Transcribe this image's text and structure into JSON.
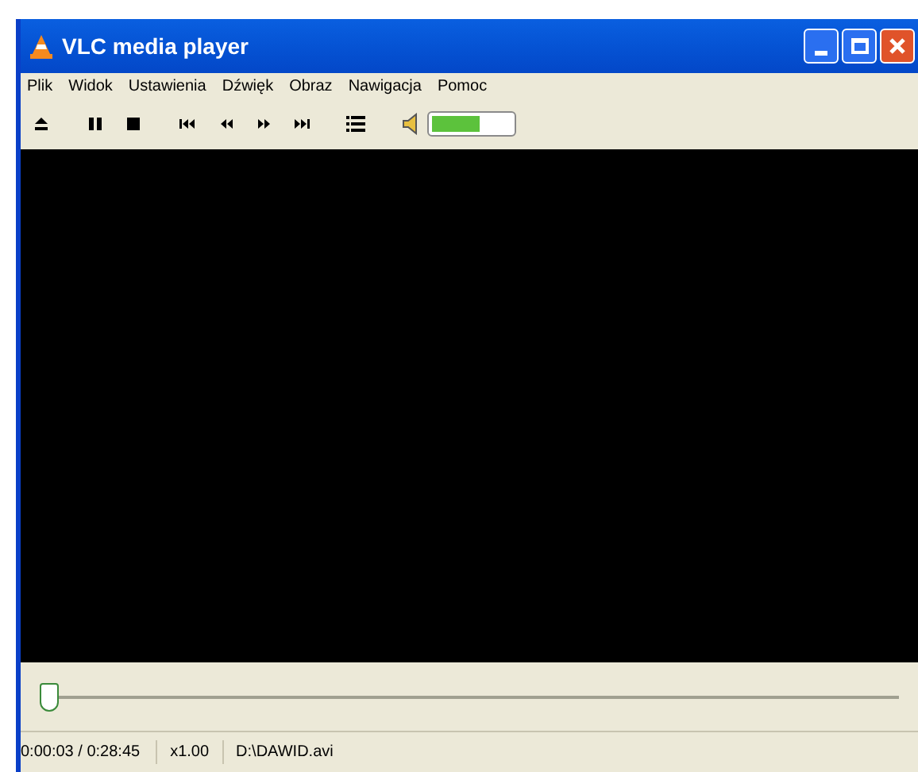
{
  "window": {
    "title": "VLC media player"
  },
  "menu": [
    "Plik",
    "Widok",
    "Ustawienia",
    "Dźwięk",
    "Obraz",
    "Nawigacja",
    "Pomoc"
  ],
  "toolbar": {
    "volume": {
      "level": 0.6
    }
  },
  "seek": {
    "level": 0.0
  },
  "status_bar": {
    "time": "0:00:03 / 0:28:45",
    "speed": "x1.00",
    "file": "D:\\DAWID.avi"
  }
}
